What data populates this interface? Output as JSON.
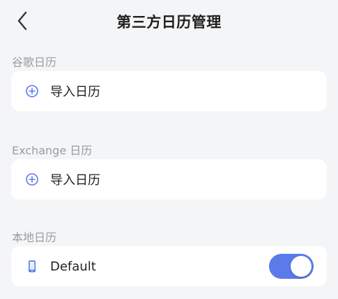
{
  "header": {
    "title": "第三方日历管理"
  },
  "sections": [
    {
      "label": "谷歌日历",
      "action_label": "导入日历",
      "icon": "plus-circle-icon"
    },
    {
      "label": "Exchange 日历",
      "action_label": "导入日历",
      "icon": "plus-circle-icon"
    },
    {
      "label": "本地日历",
      "item_label": "Default",
      "icon": "phone-icon",
      "toggle_on": true
    }
  ],
  "colors": {
    "accent": "#5b7bea",
    "background": "#f4f5f7",
    "card": "#ffffff",
    "label": "#9a9ca3"
  }
}
